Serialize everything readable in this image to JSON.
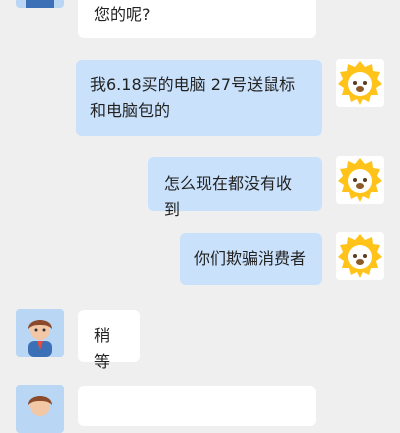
{
  "messages": [
    {
      "side": "left",
      "text": "您的呢?"
    },
    {
      "side": "right",
      "text": "我6.18买的电脑 27号送鼠标和电脑包的"
    },
    {
      "side": "right",
      "text": "怎么现在都没有收到"
    },
    {
      "side": "right",
      "text": "你们欺骗消费者"
    },
    {
      "side": "left",
      "text": "稍等"
    },
    {
      "side": "left",
      "text": ""
    }
  ],
  "avatars": {
    "agent": "agent-cartoon-avatar",
    "customer": "lion-mascot-avatar"
  },
  "colors": {
    "background": "#efefef",
    "left_bubble": "#ffffff",
    "right_bubble": "#c9e1fb",
    "lion_face": "#ffc31a"
  }
}
